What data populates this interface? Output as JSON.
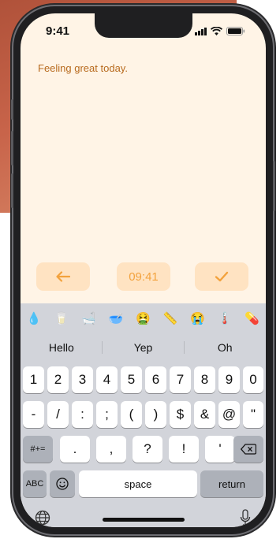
{
  "status": {
    "time": "9:41"
  },
  "note": {
    "text": "Feeling great today."
  },
  "toolbar": {
    "back_icon": "arrow-left-icon",
    "time": "09:41",
    "done_icon": "checkmark-icon",
    "accent": "#f3a23d"
  },
  "emoji_bar": [
    "💧",
    "🥛",
    "🛁",
    "🥣",
    "🤮",
    "📏",
    "😭",
    "🌡️",
    "💊"
  ],
  "suggestions": [
    "Hello",
    "Yep",
    "Oh"
  ],
  "keys": {
    "row1": [
      "1",
      "2",
      "3",
      "4",
      "5",
      "6",
      "7",
      "8",
      "9",
      "0"
    ],
    "row2": [
      "-",
      "/",
      ":",
      ";",
      "(",
      ")",
      "$",
      "&",
      "@",
      "\""
    ],
    "row3_symbols": "#+=",
    "row3": [
      ".",
      ",",
      "?",
      "!",
      "'"
    ],
    "row4_abc": "ABC",
    "space": "space",
    "return": "return"
  }
}
